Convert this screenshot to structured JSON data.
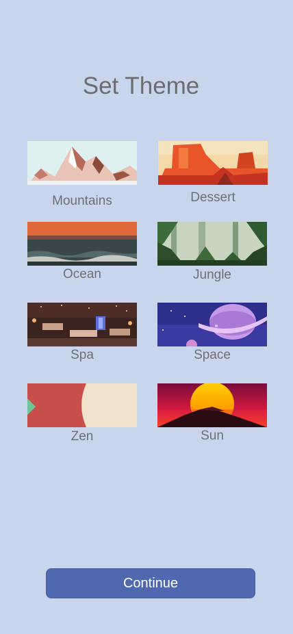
{
  "page": {
    "title": "Set Theme"
  },
  "themes": [
    {
      "label": "Mountains",
      "icon": "mountains-image"
    },
    {
      "label": "Dessert",
      "icon": "desert-image"
    },
    {
      "label": "Ocean",
      "icon": "ocean-image"
    },
    {
      "label": "Jungle",
      "icon": "jungle-image"
    },
    {
      "label": "Spa",
      "icon": "spa-image"
    },
    {
      "label": "Space",
      "icon": "space-image"
    },
    {
      "label": "Zen",
      "icon": "zen-image"
    },
    {
      "label": "Sun",
      "icon": "sun-image"
    }
  ],
  "continue_label": "Continue",
  "colors": {
    "background": "#c9d5ec",
    "button": "#5068b0",
    "text": "#6d7075"
  }
}
